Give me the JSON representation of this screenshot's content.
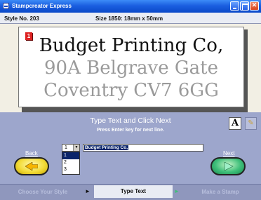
{
  "window": {
    "title": "Stampcreator Express"
  },
  "info": {
    "style_no": "Style No. 203",
    "size": "Size 1850: 18mm x 50mm"
  },
  "stamp": {
    "active_line": "1",
    "lines": [
      "Budget Printing Co,",
      "90A Belgrave Gate",
      "Coventry  CV7 6GG"
    ]
  },
  "prompt": {
    "title": "Type Text and Click Next",
    "subtitle": "Press Enter key for next line."
  },
  "tools": {
    "font_label": "A"
  },
  "editor": {
    "line_value": "1",
    "line_options": [
      "1",
      "2",
      "3"
    ],
    "text_value": "Budget Printing Co,"
  },
  "nav": {
    "back_label": "Back",
    "next_label": "Next"
  },
  "steps": {
    "step1": "Choose Your Style",
    "step2": "Type Text",
    "step3": "Make a Stamp",
    "arrow": "►"
  },
  "colors": {
    "title_bar": "#1b5fe0",
    "panel": "#9da6cc",
    "back_button": "#f3dc3a",
    "next_button": "#3fbf7a",
    "active_line_badge": "#dd2222"
  }
}
